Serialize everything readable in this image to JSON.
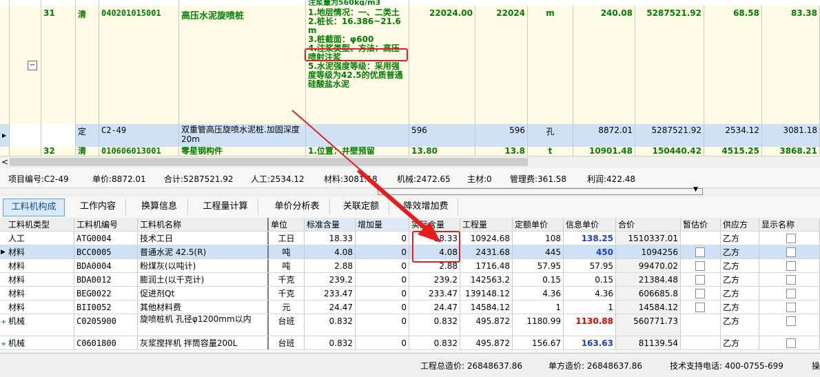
{
  "upper_rows": {
    "top_partial": "注浆量为560kg/m3",
    "r31": {
      "no": "31",
      "type": "清",
      "code": "040201015001",
      "name": "高压水泥旋喷桩",
      "feature": "1.地层情况：一、二类土\n2.桩长：16.386~21.6m\n3.桩截面：φ600\n4.注浆类型、方法：高压喷射注浆\n5.水泥强度等级：采用强度等级为42.5的优质普通硅酸盐水泥",
      "qty_expr": "22024.00",
      "qty": "22024",
      "unit": "m",
      "price": "240.08",
      "total": "5287521.92",
      "labor": "68.58",
      "mat": "83.38",
      "expand": "⊟"
    },
    "ding": {
      "type": "定",
      "code": "C2-49",
      "name": "双重管高压旋喷水泥桩.加固深度20m",
      "qty_expr": "596",
      "qty": "596",
      "unit": "孔",
      "price": "8872.01",
      "total": "5287521.92",
      "labor": "2534.12",
      "mat": "3081.18",
      "indicator": "▶"
    },
    "r32": {
      "no": "32",
      "type": "清",
      "code": "010606013001",
      "name": "零星钢构件",
      "feature": "1.位置：井壁预留",
      "qty_expr": "13.80",
      "qty": "13.8",
      "unit": "t",
      "price": "10901.48",
      "total": "150440.42",
      "labor": "4515.25",
      "mat": "3868.21"
    }
  },
  "scroll_left": "<",
  "info": {
    "item_code": "项目编号:C2-49",
    "unit_price": "单价:8872.01",
    "total": "合计:5287521.92",
    "labor": "人工:2534.12",
    "material": "材料:3081.18",
    "machine": "机械:2472.65",
    "main_mat": "主材:0",
    "mgmt": "管理费:361.58",
    "profit": "利润:422.48"
  },
  "tabs": [
    "工料机构成",
    "工作内容",
    "换算信息",
    "工程量计算",
    "单价分析表",
    "关联定额",
    "降效增加费"
  ],
  "columns": [
    "工料机类型",
    "工料机编号",
    "工料机名称",
    "单位",
    "标准含量",
    "增加量",
    "实际含量",
    "工程量",
    "定额单价",
    "信息单价",
    "合价",
    "暂估价",
    "供应方",
    "显示名称"
  ],
  "rows": [
    {
      "kind": "人工",
      "code": "ATG0004",
      "name": "技术工日",
      "unit": "工日",
      "std": "18.33",
      "add": "0",
      "actual": "18.33",
      "qty": "10924.68",
      "quota": "108",
      "info": "138.25",
      "total": "1510337.01",
      "supplier": "乙方",
      "info_color": "blue",
      "has_check": false
    },
    {
      "kind": "材料",
      "code": "BCC0005",
      "name": "普通水泥 42.5(R)",
      "unit": "吨",
      "std": "4.08",
      "add": "0",
      "actual": "4.08",
      "qty": "2431.68",
      "quota": "445",
      "info": "450",
      "total": "1094256",
      "supplier": "乙方",
      "info_color": "blue",
      "has_check": true
    },
    {
      "kind": "材料",
      "code": "BDA0004",
      "name": "粉煤灰(以吨计)",
      "unit": "吨",
      "std": "2.88",
      "add": "0",
      "actual": "2.88",
      "qty": "1716.48",
      "quota": "57.95",
      "info": "57.95",
      "total": "99470.02",
      "supplier": "乙方",
      "info_color": "",
      "has_check": true
    },
    {
      "kind": "材料",
      "code": "BDA0012",
      "name": "膨润土(以千克计)",
      "unit": "千克",
      "std": "239.2",
      "add": "0",
      "actual": "239.2",
      "qty": "142563.2",
      "quota": "0.15",
      "info": "0.15",
      "total": "21384.48",
      "supplier": "乙方",
      "info_color": "",
      "has_check": true
    },
    {
      "kind": "材料",
      "code": "BEG0022",
      "name": "促进剂Qt",
      "unit": "千克",
      "std": "233.47",
      "add": "0",
      "actual": "233.47",
      "qty": "139148.12",
      "quota": "4.36",
      "info": "4.36",
      "total": "606685.8",
      "supplier": "乙方",
      "info_color": "",
      "has_check": true
    },
    {
      "kind": "材料",
      "code": "BII0052",
      "name": "其他材料费",
      "unit": "元",
      "std": "24.47",
      "add": "0",
      "actual": "24.47",
      "qty": "14584.12",
      "quota": "1",
      "info": "1",
      "total": "14584.12",
      "supplier": "乙方",
      "info_color": "",
      "has_check": true
    },
    {
      "kind": "机械",
      "code": "C0205900",
      "name": "旋喷桩机 孔径φ1200mm以内",
      "unit": "台班",
      "std": "0.832",
      "add": "0",
      "actual": "0.832",
      "qty": "495.872",
      "quota": "1180.99",
      "info": "1130.88",
      "total": "560771.73",
      "supplier": "乙方",
      "info_color": "red",
      "has_check": false
    },
    {
      "kind": "机械",
      "code": "C0601800",
      "name": "灰浆搅拌机 拌筒容量200L",
      "unit": "台班",
      "std": "0.832",
      "add": "0",
      "actual": "0.832",
      "qty": "495.872",
      "quota": "156.67",
      "info": "163.63",
      "total": "81139.54",
      "supplier": "乙方",
      "info_color": "blue",
      "has_check": false
    }
  ],
  "status": {
    "total_cost": "工程总造价: 26848637.86",
    "unit_cost": "单方造价: 26848637.86",
    "support": "技术支持电话: 400-0755-699",
    "tail": "操"
  },
  "colors": {
    "accent": "#e81c1c",
    "green_text": "#008000",
    "selected_row": "#cfe2f5",
    "blue_value": "#1a3cd8"
  }
}
